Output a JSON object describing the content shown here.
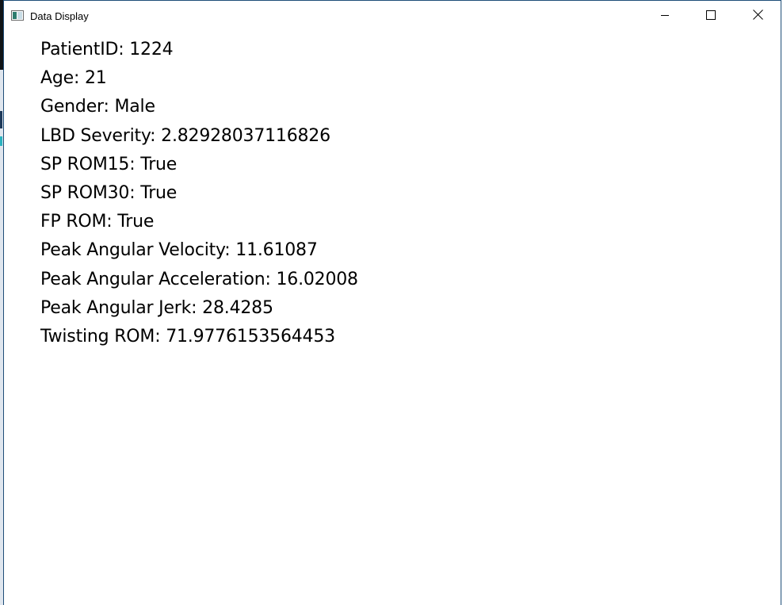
{
  "window": {
    "title": "Data Display",
    "icons": {
      "app": "app-window-icon",
      "minimize": "minimize-icon",
      "maximize": "maximize-icon",
      "close": "close-icon"
    }
  },
  "fields": [
    {
      "label": "PatientID",
      "value": "1224",
      "text": "PatientID: 1224"
    },
    {
      "label": "Age",
      "value": "21",
      "text": "Age: 21"
    },
    {
      "label": "Gender",
      "value": "Male",
      "text": "Gender: Male"
    },
    {
      "label": "LBD Severity",
      "value": "2.82928037116826",
      "text": "LBD Severity: 2.82928037116826"
    },
    {
      "label": "SP ROM15",
      "value": "True",
      "text": "SP ROM15: True"
    },
    {
      "label": "SP ROM30",
      "value": "True",
      "text": "SP ROM30: True"
    },
    {
      "label": "FP ROM",
      "value": "True",
      "text": "FP ROM: True"
    },
    {
      "label": "Peak Angular Velocity",
      "value": "11.61087",
      "text": "Peak Angular Velocity: 11.61087"
    },
    {
      "label": "Peak Angular Acceleration",
      "value": "16.02008",
      "text": "Peak Angular Acceleration: 16.02008"
    },
    {
      "label": "Peak Angular Jerk",
      "value": "28.4285",
      "text": "Peak Angular Jerk: 28.4285"
    },
    {
      "label": "Twisting ROM",
      "value": "71.9776153564453",
      "text": "Twisting ROM: 71.9776153564453"
    }
  ]
}
